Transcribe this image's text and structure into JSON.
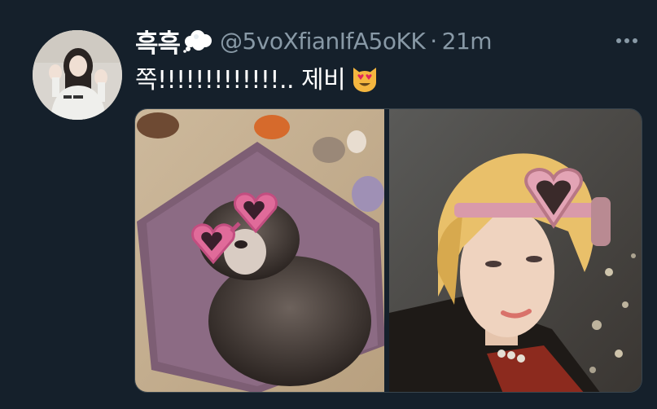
{
  "tweet": {
    "display_name": "흑흑",
    "handle": "@5voXfianIfA5oKK",
    "separator": "·",
    "time": "21m",
    "text": "쪽!!!!!!!!!!!!!.. 제비"
  },
  "icons": {
    "name_badge": "thought-balloon-emoji",
    "text_emoji": "smiling-cat-heart-eyes-emoji",
    "more": "more-horizontal-icon"
  },
  "colors": {
    "background": "#15202b",
    "primary_text": "#ffffff",
    "secondary_text": "#8899a6",
    "border": "#38444d"
  },
  "media": {
    "count": 2,
    "images": [
      {
        "subject": "ferret-with-pink-heart-sunglasses"
      },
      {
        "subject": "blonde-person-with-pink-heart-goggles"
      }
    ]
  }
}
